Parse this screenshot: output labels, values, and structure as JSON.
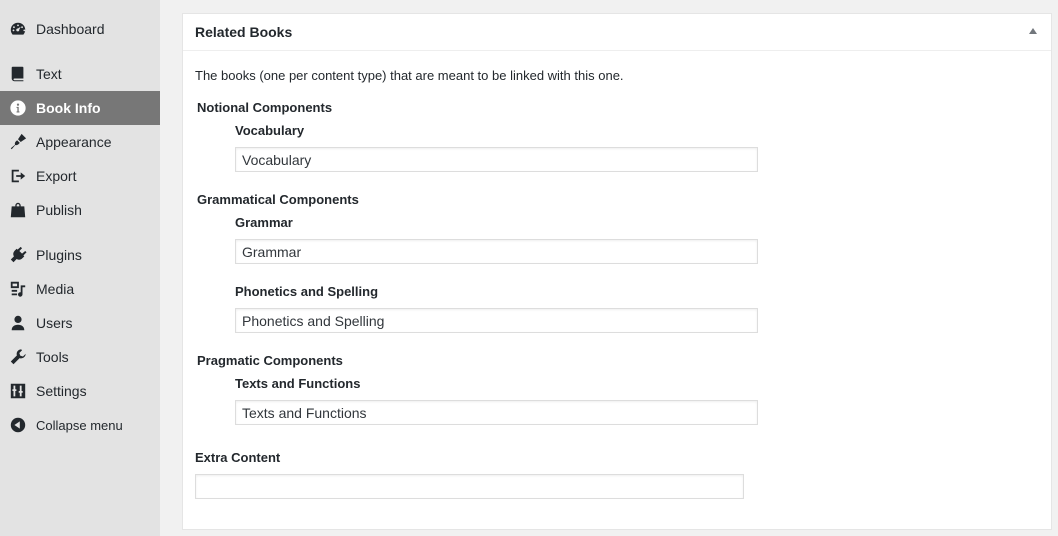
{
  "sidebar": {
    "items": [
      {
        "label": "Dashboard",
        "icon": "dashboard-icon"
      },
      {
        "label": "Text",
        "icon": "book-icon"
      },
      {
        "label": "Book Info",
        "icon": "info-icon",
        "active": true
      },
      {
        "label": "Appearance",
        "icon": "brush-icon"
      },
      {
        "label": "Export",
        "icon": "export-icon"
      },
      {
        "label": "Publish",
        "icon": "store-icon"
      },
      {
        "label": "Plugins",
        "icon": "plug-icon"
      },
      {
        "label": "Media",
        "icon": "media-icon"
      },
      {
        "label": "Users",
        "icon": "user-icon"
      },
      {
        "label": "Tools",
        "icon": "wrench-icon"
      },
      {
        "label": "Settings",
        "icon": "sliders-icon"
      },
      {
        "label": "Collapse menu",
        "icon": "collapse-icon"
      }
    ]
  },
  "panel": {
    "title": "Related Books",
    "description": "The books (one per content type) that are meant to be linked with this one.",
    "groups": [
      {
        "label": "Notional Components",
        "fields": [
          {
            "label": "Vocabulary",
            "value": "Vocabulary"
          }
        ]
      },
      {
        "label": "Grammatical Components",
        "fields": [
          {
            "label": "Grammar",
            "value": "Grammar"
          },
          {
            "label": "Phonetics and Spelling",
            "value": "Phonetics and Spelling"
          }
        ]
      },
      {
        "label": "Pragmatic Components",
        "fields": [
          {
            "label": "Texts and Functions",
            "value": "Texts and Functions"
          }
        ]
      }
    ],
    "extra": {
      "label": "Extra Content",
      "value": ""
    }
  },
  "colors": {
    "sidebar_bg": "#e3e3e3",
    "active_bg": "#777777",
    "page_bg": "#f1f1f1"
  }
}
